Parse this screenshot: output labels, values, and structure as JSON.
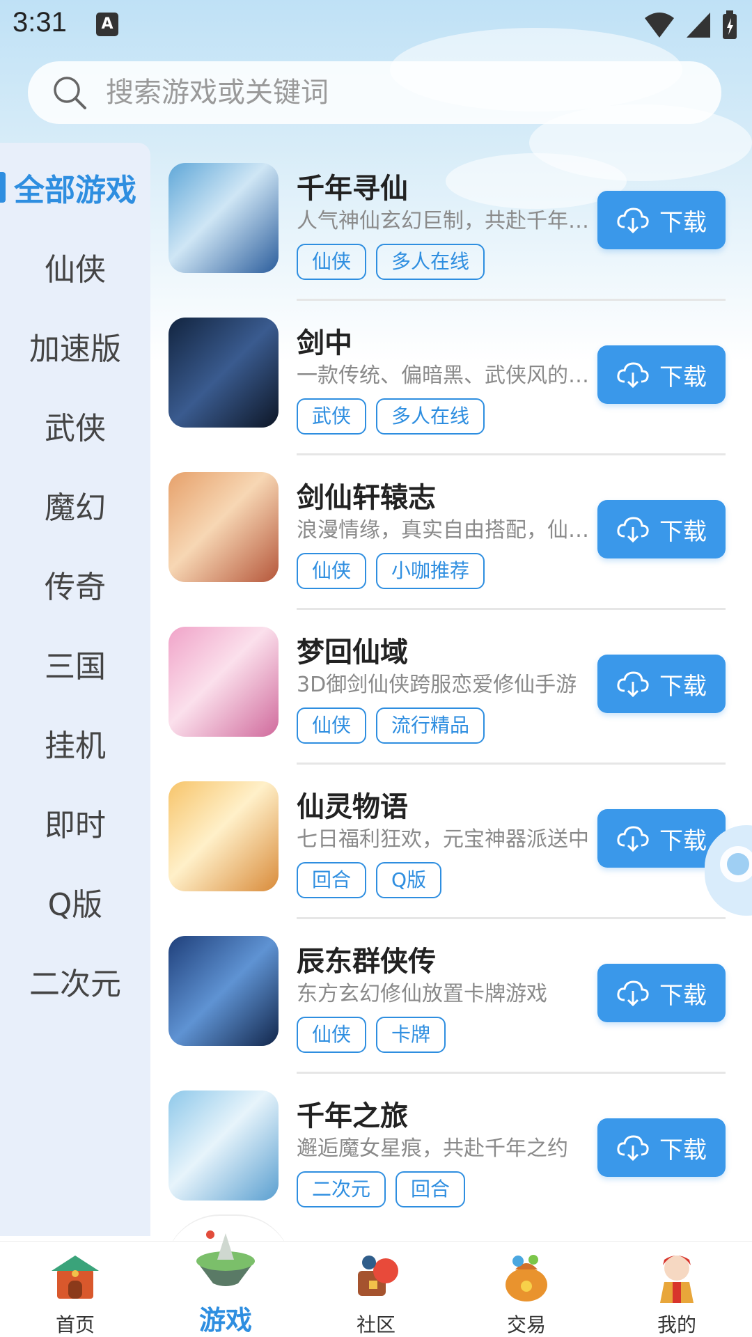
{
  "status_bar": {
    "time": "3:31",
    "notification_badge": "A"
  },
  "search": {
    "placeholder": "搜索游戏或关键词"
  },
  "sidebar": {
    "items": [
      {
        "label": "全部游戏",
        "active": true
      },
      {
        "label": "仙侠"
      },
      {
        "label": "加速版"
      },
      {
        "label": "武侠"
      },
      {
        "label": "魔幻"
      },
      {
        "label": "传奇"
      },
      {
        "label": "三国"
      },
      {
        "label": "挂机"
      },
      {
        "label": "即时"
      },
      {
        "label": "Q版"
      },
      {
        "label": "二次元"
      }
    ]
  },
  "games": [
    {
      "title": "千年寻仙",
      "desc": "人气神仙玄幻巨制，共赴千年仙途",
      "tags": [
        "仙侠",
        "多人在线"
      ],
      "button": "下载"
    },
    {
      "title": "剑中",
      "desc": "一款传统、偏暗黑、武侠风的手游",
      "tags": [
        "武侠",
        "多人在线"
      ],
      "button": "下载"
    },
    {
      "title": "剑仙轩辕志",
      "desc": "浪漫情缘，真实自由搭配，仙侠之旅",
      "tags": [
        "仙侠",
        "小咖推荐"
      ],
      "button": "下载"
    },
    {
      "title": "梦回仙域",
      "desc": "3D御剑仙侠跨服恋爱修仙手游",
      "tags": [
        "仙侠",
        "流行精品"
      ],
      "button": "下载"
    },
    {
      "title": "仙灵物语",
      "desc": "七日福利狂欢，元宝神器派送中",
      "tags": [
        "回合",
        "Q版"
      ],
      "button": "下载"
    },
    {
      "title": "辰东群侠传",
      "desc": "东方玄幻修仙放置卡牌游戏",
      "tags": [
        "仙侠",
        "卡牌"
      ],
      "button": "下载"
    },
    {
      "title": "千年之旅",
      "desc": "邂逅魔女星痕，共赴千年之约",
      "tags": [
        "二次元",
        "回合"
      ],
      "button": "下载"
    }
  ],
  "bottom_nav": [
    {
      "label": "首页",
      "icon": "home-gate-icon"
    },
    {
      "label": "游戏",
      "icon": "game-island-icon",
      "active": true
    },
    {
      "label": "社区",
      "icon": "community-icon"
    },
    {
      "label": "交易",
      "icon": "trade-bag-icon"
    },
    {
      "label": "我的",
      "icon": "profile-character-icon"
    }
  ],
  "colors": {
    "accent": "#3a98ea",
    "sidebar_bg": "#e8effa",
    "active_text": "#2e8ee0"
  }
}
